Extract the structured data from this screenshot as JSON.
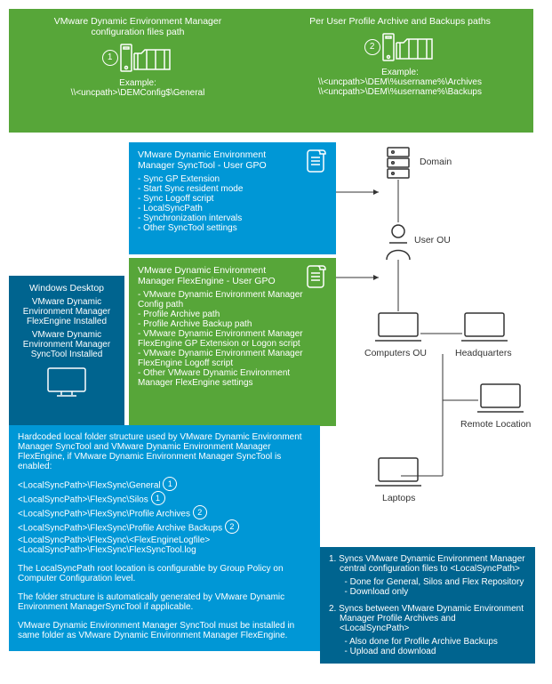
{
  "card1": {
    "title": "VMware Dynamic Environment Manager\nconfiguration files path",
    "example_label": "Example:",
    "example_path": "\\\\<uncpath>\\DEMConfig$\\General",
    "num": "1"
  },
  "card2": {
    "title": "Per User Profile Archive and Backups paths",
    "example_label": "Example:",
    "example_path1": "\\\\<uncpath>\\DEM\\%username%\\Archives",
    "example_path2": "\\\\<uncpath>\\DEM\\%username%\\Backups",
    "num": "2"
  },
  "sync_gpo": {
    "title": "VMware Dynamic Environment\nManager SyncTool - User GPO",
    "items": [
      "Sync GP Extension",
      "Start Sync resident mode",
      "Sync Logoff script",
      "LocalSyncPath",
      "Synchronization intervals",
      "Other SyncTool settings"
    ]
  },
  "flex_gpo": {
    "title": "VMware Dynamic Environment\nManager FlexEngine - User GPO",
    "items": [
      "VMware Dynamic Environment Manager Config path",
      "Profile Archive path",
      "Profile Archive Backup path",
      "VMware Dynamic Environment Manager FlexEngine GP Extension or Logon script",
      "VMware Dynamic Environment Manager FlexEngine Logoff script",
      "Other VMware Dynamic Environment Manager FlexEngine settings"
    ]
  },
  "desktop": {
    "title": "Windows Desktop",
    "line1": "VMware Dynamic Environment Manager FlexEngine Installed",
    "line2": "VMware Dynamic Environment Manager SyncTool Installed"
  },
  "hardcoded": {
    "intro": "Hardcoded local folder structure used by VMware Dynamic Environment Manager SyncTool and VMware Dynamic Environment Manager FlexEngine, if VMware Dynamic Environment Manager SyncTool is enabled:",
    "paths": [
      "<LocalSyncPath>\\FlexSync\\General",
      "<LocalSyncPath>\\FlexSync\\Silos",
      "<LocalSyncPath>\\FlexSync\\Profile Archives",
      "<LocalSyncPath>\\FlexSync\\Profile Archive Backups",
      "<LocalSyncPath>\\FlexSync\\<FlexEngineLogfile>",
      "<LocalSyncPath>\\FlexSync\\FlexSyncTool.log"
    ],
    "badge_gen": "1",
    "badge_arc": "2",
    "p1": "The LocalSyncPath root location is configurable by Group Policy on Computer Configuration level.",
    "p2": "The folder structure is automatically generated by VMware Dynamic Environment ManagerSyncTool if applicable.",
    "p3": "VMware Dynamic Environment Manager SyncTool must be installed in same folder as VMware Dynamic Environment Manager FlexEngine."
  },
  "notes": {
    "n1_head": "1. Syncs VMware Dynamic Environment Manager central configuration files to <LocalSyncPath>",
    "n1_a": "Done for General, Silos and Flex Repository",
    "n1_b": "Download only",
    "n2_head": "2. Syncs between VMware Dynamic Environment Manager Profile Archives and <LocalSyncPath>",
    "n2_a": "Also done for Profile Archive Backups",
    "n2_b": "Upload and download"
  },
  "tree": {
    "domain": "Domain",
    "user_ou": "User OU",
    "computers": "Computers OU",
    "hq": "Headquarters",
    "remote": "Remote Location",
    "laptops": "Laptops"
  }
}
